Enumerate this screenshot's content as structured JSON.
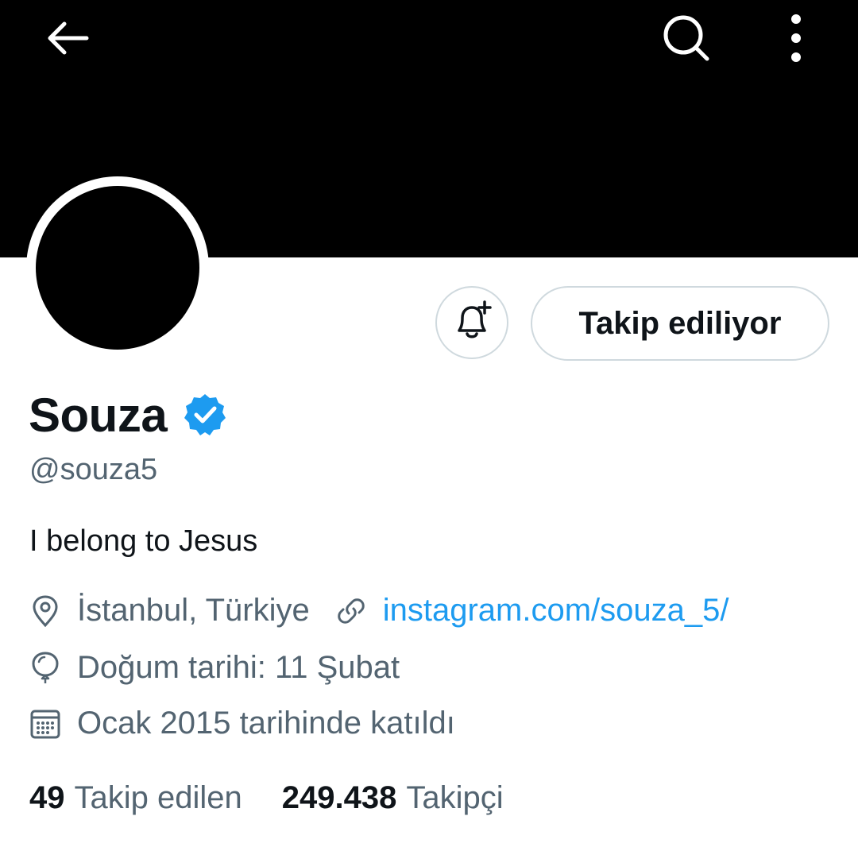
{
  "header": {
    "icons": [
      "back-arrow-icon",
      "search-icon",
      "more-vertical-icon"
    ]
  },
  "profile": {
    "display_name": "Souza",
    "handle": "@souza5",
    "bio": "I belong to Jesus",
    "location": "İstanbul, Türkiye",
    "website": "instagram.com/souza_5/",
    "birthday": "Doğum tarihi: 11 Şubat",
    "joined": "Ocak 2015 tarihinde katıldı",
    "verified": true
  },
  "actions": {
    "follow_label": "Takip ediliyor",
    "notify_icon": "bell-plus-icon"
  },
  "stats": {
    "following_count": "49",
    "following_label": "Takip edilen",
    "followers_count": "249.438",
    "followers_label": "Takipçi"
  },
  "colors": {
    "banner": "#000000",
    "text_primary": "#0f1419",
    "text_secondary": "#536471",
    "link": "#1d9bf0",
    "verified": "#1d9bf0",
    "button_border": "#cfd9de"
  }
}
